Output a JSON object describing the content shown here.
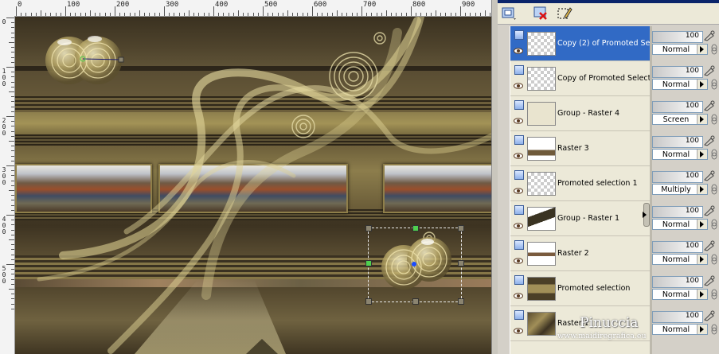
{
  "ruler": {
    "top_labels": [
      "0",
      "100",
      "200",
      "300",
      "400",
      "500",
      "600",
      "700",
      "800",
      "900"
    ],
    "left_labels": [
      "0",
      "1\n0\n0",
      "2\n0\n0",
      "3\n0\n0",
      "4\n0\n0",
      "5\n0\n0"
    ]
  },
  "canvas": {
    "description_icons": [
      "sphere-icon",
      "ribbon-icon",
      "spiral-icon"
    ]
  },
  "toolbar": {
    "buttons": [
      {
        "name": "new-layer-icon"
      },
      {
        "name": "delete-layer-icon"
      },
      {
        "name": "edit-selection-icon"
      }
    ]
  },
  "layers": [
    {
      "name": "Copy (2) of Promoted Se",
      "opacity": "100",
      "blend": "Normal",
      "selected": true,
      "expandable": false
    },
    {
      "name": "Copy of Promoted Select",
      "opacity": "100",
      "blend": "Normal",
      "selected": false,
      "expandable": false
    },
    {
      "name": "Group - Raster 4",
      "opacity": "100",
      "blend": "Screen",
      "selected": false,
      "expandable": true
    },
    {
      "name": "Raster 3",
      "opacity": "100",
      "blend": "Normal",
      "selected": false,
      "expandable": false
    },
    {
      "name": "Promoted selection 1",
      "opacity": "100",
      "blend": "Multiply",
      "selected": false,
      "expandable": false
    },
    {
      "name": "Group - Raster 1",
      "opacity": "100",
      "blend": "Normal",
      "selected": false,
      "expandable": true
    },
    {
      "name": "Raster 2",
      "opacity": "100",
      "blend": "Normal",
      "selected": false,
      "expandable": false
    },
    {
      "name": "Promoted selection",
      "opacity": "100",
      "blend": "Normal",
      "selected": false,
      "expandable": false
    },
    {
      "name": "Raster 1",
      "opacity": "100",
      "blend": "Normal",
      "selected": false,
      "expandable": false
    }
  ],
  "watermark": {
    "name": "Pinuccia",
    "site": "www.maidiregrafica.eu"
  },
  "colors": {
    "selected_row": "#316ac5",
    "palette_bg": "#d4d0c8",
    "canvas_gold": "#d9cd8c"
  }
}
